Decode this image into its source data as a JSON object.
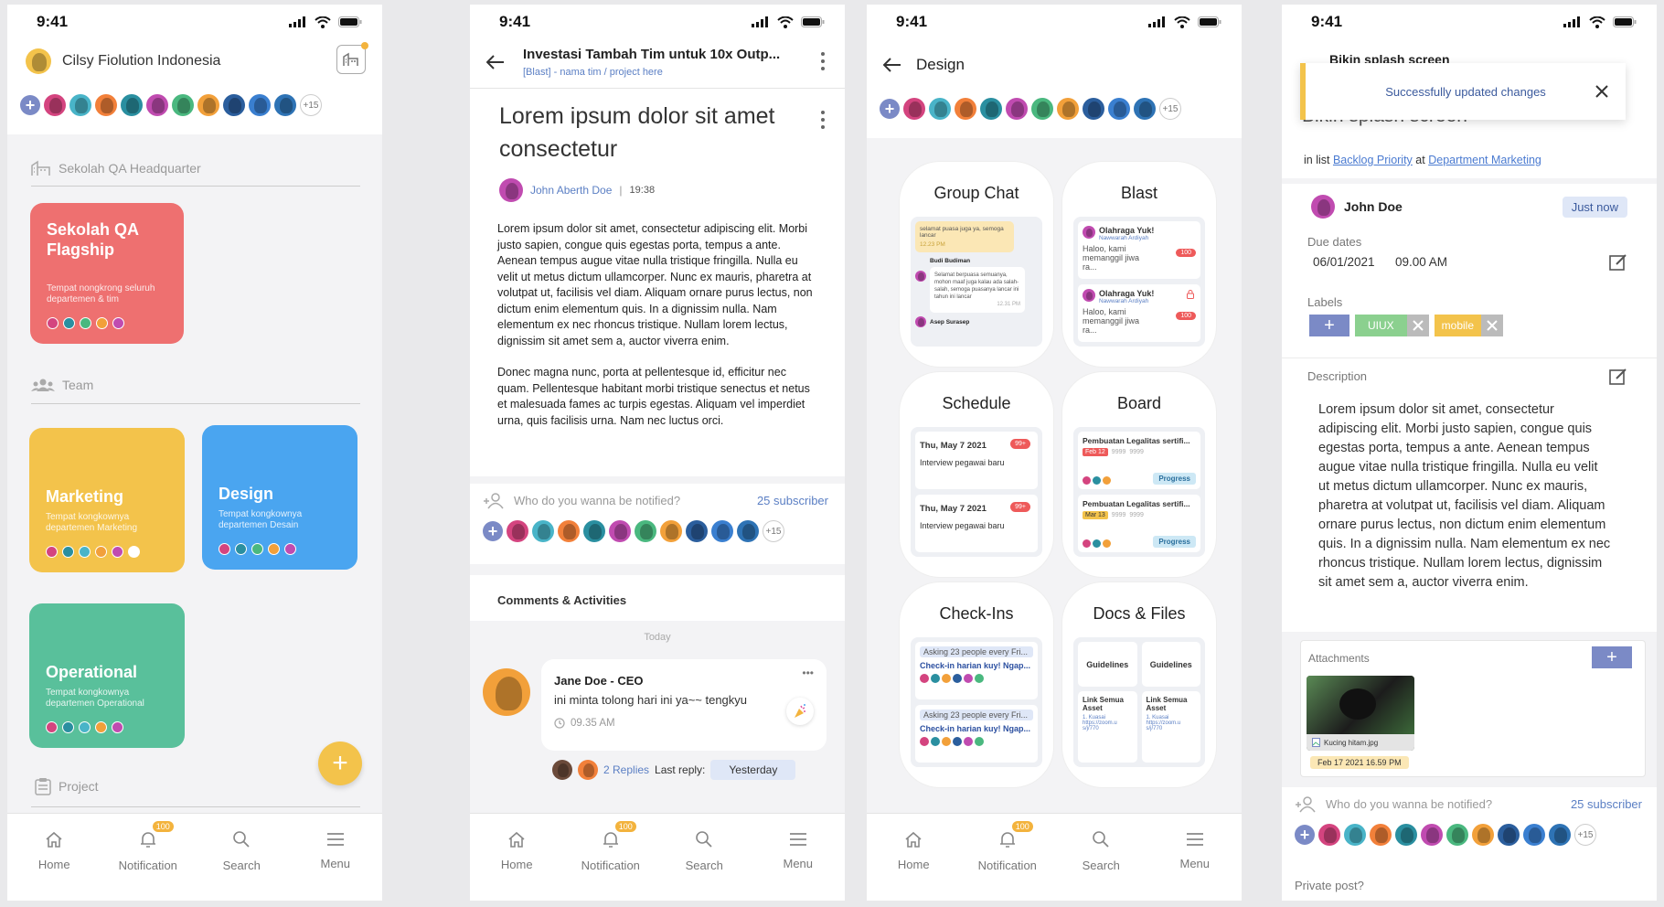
{
  "status": {
    "time": "9:41"
  },
  "colors": {
    "accent": "#7b8ac6",
    "yellow": "#f3c34b",
    "red": "#ee7070",
    "blue": "#4aa5f0",
    "green": "#59c09b",
    "badge": "#f3b33d"
  },
  "avatar_colors": [
    "#d4447f",
    "#49b4c8",
    "#f2803a",
    "#2a8fa0",
    "#c04bb0",
    "#4ab87f",
    "#f2a03a",
    "#2b5e9d",
    "#3a7fd0",
    "#2e73b5"
  ],
  "more_count": "+15",
  "tabbar": {
    "items": [
      {
        "label": "Home",
        "icon": "home-icon"
      },
      {
        "label": "Notification",
        "icon": "bell-icon"
      },
      {
        "label": "Search",
        "icon": "search-icon"
      },
      {
        "label": "Menu",
        "icon": "menu-icon"
      }
    ],
    "badge": "100"
  },
  "screen1": {
    "org_name": "Cilsy Fiolution Indonesia",
    "hq_section": "Sekolah QA Headquarter",
    "hq_card": {
      "title": "Sekolah QA Flagship",
      "subtitle": "Tempat nongkrong seluruh departemen & tim"
    },
    "team_section": "Team",
    "teams": [
      {
        "title": "Marketing",
        "subtitle": "Tempat kongkownya departemen Marketing"
      },
      {
        "title": "Design",
        "subtitle": "Tempat kongkownya departemen Desain"
      },
      {
        "title": "Operational",
        "subtitle": "Tempat kongkownya departemen Operational"
      }
    ],
    "project_section": "Project",
    "fab": "+"
  },
  "screen2": {
    "header_title": "Investasi Tambah Tim untuk 10x Outp...",
    "header_sub": "[Blast] - nama tim / project here",
    "post_title": "Lorem ipsum dolor sit amet consectetur",
    "author": "John Aberth Doe",
    "time": "19:38",
    "body1": "Lorem ipsum dolor sit amet, consectetur adipiscing elit. Morbi justo sapien, congue quis egestas porta, tempus a ante. Aenean tempus augue vitae nulla tristique fringilla. Nulla eu velit ut metus dictum ullamcorper. Nunc ex mauris, pharetra at volutpat ut, facilisis vel diam. Aliquam ornare purus lectus, non dictum enim elementum quis. In a dignissim nulla. Nam elementum ex nec rhoncus tristique. Nullam lorem lectus, dignissim sit amet sem a, auctor viverra enim.",
    "body2": "Donec magna nunc, porta at pellentesque id, efficitur nec quam. Pellentesque habitant morbi tristique senectus et netus et malesuada fames ac turpis egestas. Aliquam vel imperdiet urna, quis facilisis urna. Nam nec luctus orci.",
    "notify_placeholder": "Who do you wanna be notified?",
    "subscriber": "25 subscriber",
    "comments_title": "Comments & Activities",
    "today": "Today",
    "comment": {
      "author": "Jane Doe - CEO",
      "text": "ini minta tolong hari ini ya~~ tengkyu",
      "time": "09.35 AM",
      "replies": "2 Replies",
      "last_reply_label": "Last reply:",
      "last_reply": "Yesterday",
      "menu": "•••"
    }
  },
  "screen3": {
    "title": "Design",
    "features": [
      {
        "title": "Group Chat"
      },
      {
        "title": "Blast"
      },
      {
        "title": "Schedule"
      },
      {
        "title": "Board"
      },
      {
        "title": "Check-Ins"
      },
      {
        "title": "Docs & Files"
      }
    ],
    "chat": {
      "msg1": "selamat puasa juga ya, semoga lancar",
      "msg1_time": "12.23 PM",
      "name1": "Budi Budiman",
      "msg2": "Selamat berpuasa semuanya, mohon maaf juga kalau ada salah-salah, semoga puasanya lancar ini tahun ini lancar",
      "msg2_time": "12.31 PM",
      "name2": "Asep Surasep"
    },
    "blast": [
      {
        "title": "Olahraga Yuk!",
        "author": "Nawwarah Ardiyah",
        "text": "Haloo, kami memanggil jiwa ra...",
        "count": "100"
      },
      {
        "title": "Olahraga Yuk!",
        "author": "Nawwarah Ardiyah",
        "text": "Haloo, kami memanggil jiwa ra...",
        "count": "100"
      }
    ],
    "schedule": [
      {
        "date": "Thu, May 7 2021",
        "badge": "99+",
        "text": "Interview pegawai baru"
      },
      {
        "date": "Thu, May 7 2021",
        "badge": "99+",
        "text": "Interview pegawai baru"
      }
    ],
    "board": [
      {
        "title": "Pembuatan Legalitas sertifi...",
        "date": "Feb 12",
        "c1": "9999",
        "c2": "9999",
        "status": "Progress"
      },
      {
        "title": "Pembuatan Legalitas sertifi...",
        "date": "Mar 13",
        "c1": "9999",
        "c2": "9999",
        "status": "Progress"
      }
    ],
    "checkins": [
      {
        "q": "Asking 23 people every Fri...",
        "t": "Check-in harian kuy! Ngap..."
      },
      {
        "q": "Asking 23 people every Fri...",
        "t": "Check-in harian kuy! Ngap..."
      }
    ],
    "docs": {
      "folder1": "Guidelines",
      "folder2": "Guidelines",
      "doc1": "Link Semua Asset",
      "doc1_sub": "1. Kuasai https://zoom.u s/j/770",
      "doc2": "Link Semua Asset",
      "doc2_sub": "1. Kuasai https://zoom.u s/j/770"
    }
  },
  "screen4": {
    "top_title": "Bikin splash screen",
    "toast": "Successfully updated changes",
    "big_title": "Bikin splash screen",
    "in_list": "in list",
    "list_name": "Backlog Priority",
    "at": "at",
    "dept": "Department Marketing",
    "user": "John Doe",
    "just_now": "Just now",
    "due_label": "Due dates",
    "due_date": "06/01/2021",
    "due_time": "09.00 AM",
    "labels_label": "Labels",
    "labels": [
      {
        "text": "UIUX",
        "color": "#8bd08f"
      },
      {
        "text": "mobile",
        "color": "#f3c34b"
      }
    ],
    "desc_label": "Description",
    "desc": "Lorem ipsum dolor sit amet, consectetur adipiscing elit. Morbi justo sapien, congue quis egestas porta, tempus a ante. Aenean tempus augue vitae nulla tristique fringilla. Nulla eu velit ut metus dictum ullamcorper. Nunc ex mauris, pharetra at volutpat ut, facilisis vel diam. Aliquam ornare purus lectus, non dictum enim elementum quis. In a dignissim nulla. Nam elementum ex nec rhoncus tristique. Nullam lorem lectus, dignissim sit amet sem a, auctor viverra enim.",
    "attachments_label": "Attachments",
    "file_name": "Kucing hitam.jpg",
    "file_date": "Feb 17 2021 16.59 PM",
    "notify_placeholder": "Who do you wanna be notified?",
    "subscriber": "25 subscriber",
    "private": "Private post?"
  }
}
